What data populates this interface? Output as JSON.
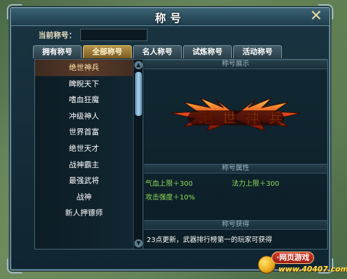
{
  "window": {
    "title": "称号",
    "close_symbol": "✕"
  },
  "current_title": {
    "label": "当前称号：",
    "value": ""
  },
  "tabs": [
    {
      "label": "拥有称号",
      "active": false
    },
    {
      "label": "全部称号",
      "active": true
    },
    {
      "label": "名人称号",
      "active": false
    },
    {
      "label": "试炼称号",
      "active": false
    },
    {
      "label": "活动称号",
      "active": false
    }
  ],
  "title_list": {
    "items": [
      {
        "label": "绝世神兵",
        "selected": true
      },
      {
        "label": "睥睨天下",
        "selected": false
      },
      {
        "label": "嗜血狂魔",
        "selected": false
      },
      {
        "label": "冲级神人",
        "selected": false
      },
      {
        "label": "世界首富",
        "selected": false
      },
      {
        "label": "绝世天才",
        "selected": false
      },
      {
        "label": "战神霸主",
        "selected": false
      },
      {
        "label": "最强武将",
        "selected": false
      },
      {
        "label": "战神",
        "selected": false
      },
      {
        "label": "新人押镖师",
        "selected": false
      }
    ],
    "scroll_up_symbol": "▲",
    "scroll_down_symbol": "▼"
  },
  "display": {
    "header": "称号展示",
    "emblem_text": [
      "绝",
      "世",
      "神",
      "兵"
    ]
  },
  "attributes": {
    "header": "称号属性",
    "items": [
      {
        "label": "气血上限＋300"
      },
      {
        "label": "法力上限＋300"
      },
      {
        "label": "攻击强度＋10%"
      }
    ]
  },
  "obtain": {
    "header": "称号获得",
    "text": "23点更新，武器排行榜第一的玩家可获得"
  },
  "watermark": {
    "badge": "·网页游戏",
    "url": "www.40407.com"
  },
  "colors": {
    "accent_gold": "#e9c96f",
    "attr_green": "#8fdc5a",
    "panel_dark": "#0d212b"
  }
}
